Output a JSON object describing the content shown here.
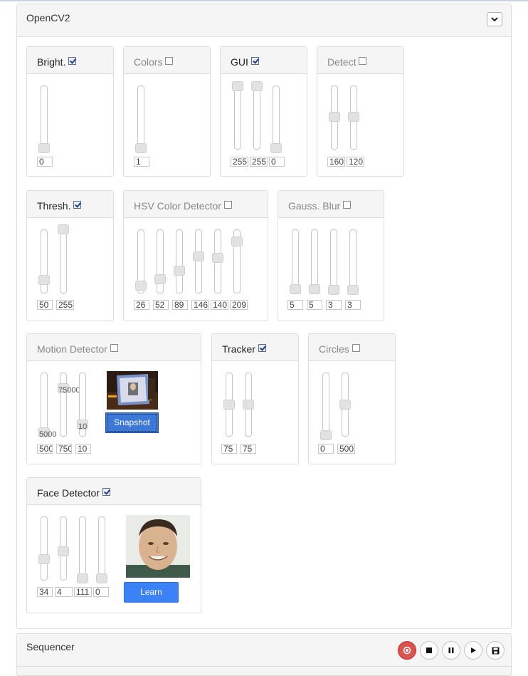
{
  "app": {
    "title": "OpenCV2"
  },
  "sequencer": {
    "title": "Sequencer",
    "controls": [
      "record-icon",
      "stop-icon",
      "pause-icon",
      "play-icon",
      "save-icon"
    ]
  },
  "colors": {
    "accent": "#3b78d8",
    "record": "#d9534f",
    "panel_header": "#f5f5f5"
  },
  "filters": {
    "bright": {
      "title": "Bright.",
      "enabled": true,
      "values": [
        "0"
      ]
    },
    "colors": {
      "title": "Colors",
      "enabled": false,
      "values": [
        "1"
      ]
    },
    "gui": {
      "title": "GUI",
      "enabled": true,
      "values": [
        "255",
        "255",
        "0"
      ]
    },
    "detect": {
      "title": "Detect",
      "enabled": false,
      "values": [
        "160",
        "120"
      ]
    },
    "thresh": {
      "title": "Thresh.",
      "enabled": true,
      "values": [
        "50",
        "255"
      ]
    },
    "hsv": {
      "title": "HSV Color Detector",
      "enabled": false,
      "values": [
        "26",
        "52",
        "89",
        "146",
        "140",
        "209"
      ]
    },
    "gauss": {
      "title": "Gauss. Blur",
      "enabled": false,
      "values": [
        "5",
        "5",
        "3",
        "3"
      ]
    },
    "motion": {
      "title": "Motion Detector",
      "enabled": false,
      "values": [
        "500",
        "750",
        "10"
      ],
      "handle_labels": [
        "5000",
        "75000",
        "10"
      ],
      "snapshot_label": "Snapshot"
    },
    "tracker": {
      "title": "Tracker",
      "enabled": true,
      "values": [
        "75",
        "75"
      ]
    },
    "circles": {
      "title": "Circles",
      "enabled": false,
      "values": [
        "0",
        "500"
      ]
    },
    "face": {
      "title": "Face Detector",
      "enabled": true,
      "values": [
        "34",
        "4",
        "111",
        "0"
      ],
      "learn_label": "Learn"
    }
  }
}
